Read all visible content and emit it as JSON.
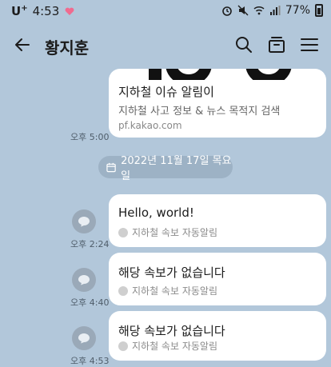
{
  "status": {
    "carrier": "U",
    "carrier_sup": "+",
    "time": "4:53",
    "battery": "77%"
  },
  "header": {
    "title": "황지훈"
  },
  "link_card": {
    "title": "지하철 이슈 알림이",
    "desc": "지하철 사고 정보 & 뉴스 목적지 검색",
    "url": "pf.kakao.com",
    "time": "오후 5:00"
  },
  "date_divider": "2022년 11월 17일 목요일",
  "messages": [
    {
      "text": "Hello, world!",
      "sender": "지하철 속보 자동알림",
      "time": "오후 2:24"
    },
    {
      "text": "해당 속보가 없습니다",
      "sender": "지하철 속보 자동알림",
      "time": "오후 4:40"
    },
    {
      "text": "해당 속보가 없습니다",
      "sender": "지하철 속보 자동알림",
      "time": "오후 4:53"
    }
  ]
}
